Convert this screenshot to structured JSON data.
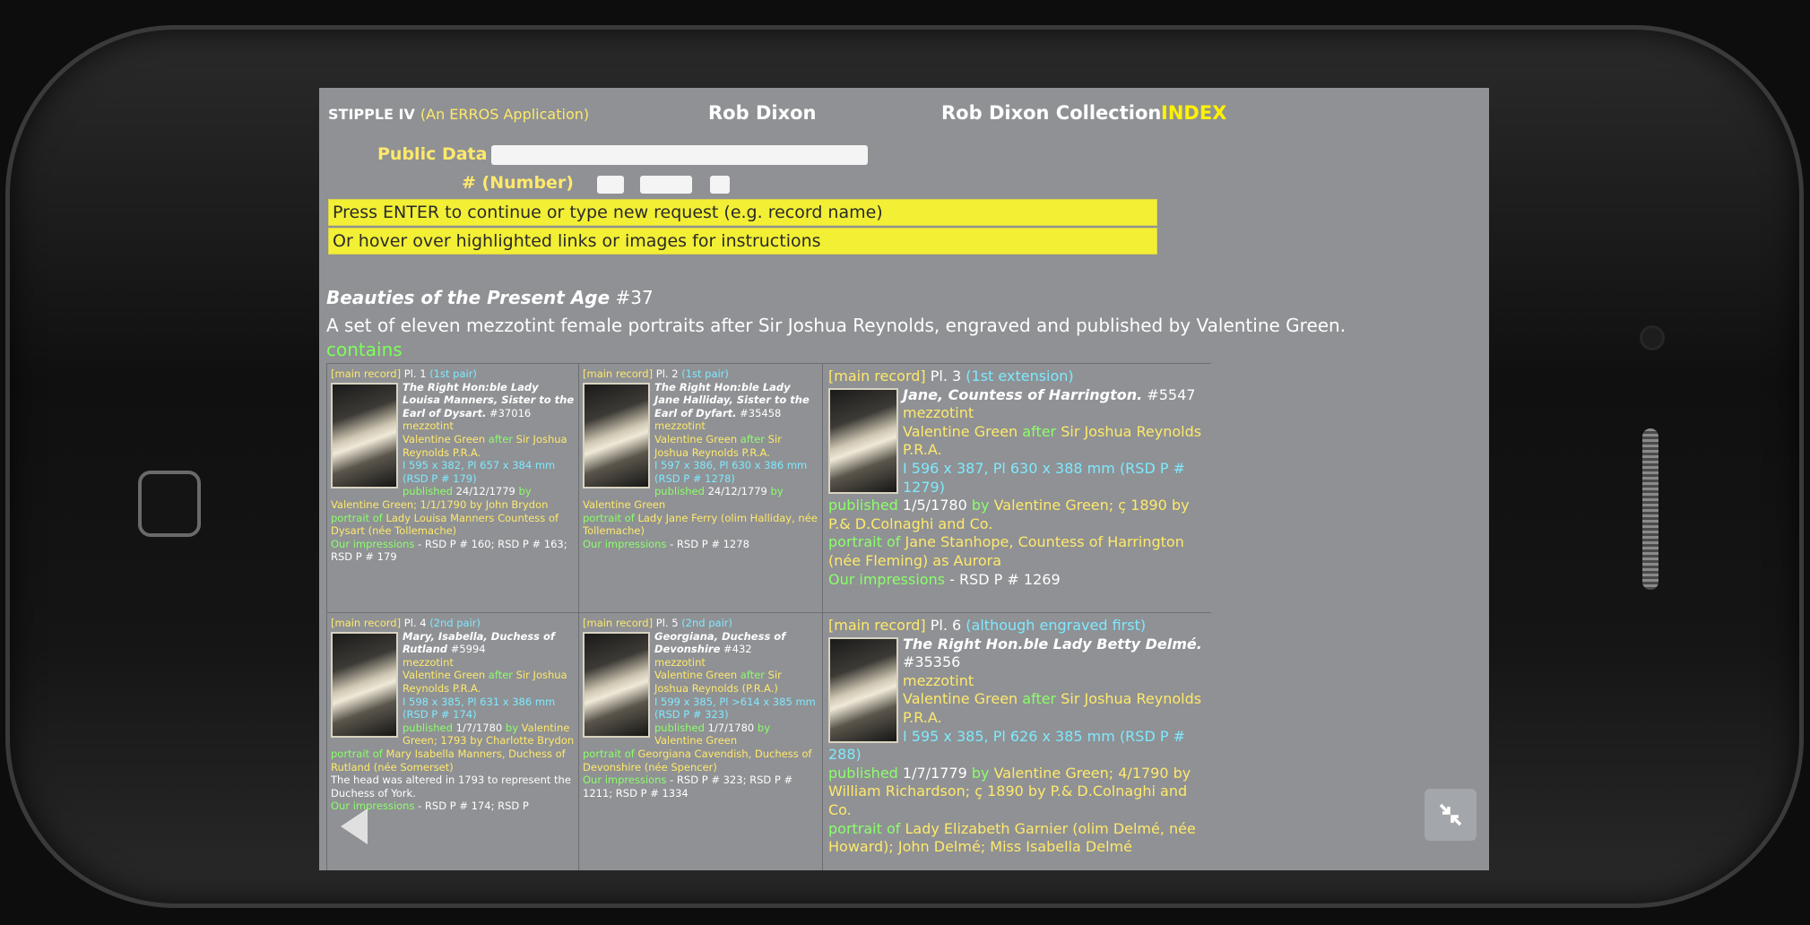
{
  "header": {
    "app_name": "STIPPLE IV",
    "app_sub": "(An ERROS Application)",
    "owner": "Rob Dixon",
    "collection": "Rob Dixon Collection",
    "index_link": "INDEX"
  },
  "search": {
    "public_label": "Public Data",
    "number_label": "# (Number)"
  },
  "notices": [
    "Press ENTER to continue or type new request (e.g. record name)",
    "Or hover over highlighted links or images for instructions"
  ],
  "record": {
    "title": "Beauties of the Present Age",
    "number": "#37",
    "description": "A set of eleven mezzotint female portraits after Sir Joshua Reynolds, engraved and published by Valentine Green.",
    "contains_label": "contains"
  },
  "cells": [
    {
      "main_record": "[main record]",
      "plate": "Pl. 1",
      "pair": "(1st pair)",
      "title": "The Right Hon:ble Lady Louisa Manners, Sister to the Earl of Dysart.",
      "record_no": "#37016",
      "medium": "mezzotint",
      "engraver": "Valentine Green",
      "after_word": "after",
      "artist": "Sir Joshua Reynolds P.R.A.",
      "dimensions": "I 595 x 382, Pl 657 x 384 mm (RSD P # 179)",
      "published_word": "published",
      "published": "24/12/1779",
      "by_word": "by",
      "publisher": "Valentine Green; 1/1/1790 by John Brydon",
      "portrait_word": "portrait of",
      "sitter": "Lady Louisa Manners Countess of Dysart (née Tollemache)",
      "impressions_label": "Our impressions",
      "impressions": "- RSD P # 160; RSD P # 163; RSD P # 179"
    },
    {
      "main_record": "[main record]",
      "plate": "Pl. 2",
      "pair": "(1st pair)",
      "title": "The Right Hon:ble Lady Jane Halliday, Sister to the Earl of Dyfart.",
      "record_no": "#35458",
      "medium": "mezzotint",
      "engraver": "Valentine Green",
      "after_word": "after",
      "artist": "Sir Joshua Reynolds P.R.A.",
      "dimensions": "I 597 x 386, Pl 630 x 386 mm (RSD P # 1278)",
      "published_word": "published",
      "published": "24/12/1779",
      "by_word": "by",
      "publisher": "Valentine Green",
      "portrait_word": "portrait of",
      "sitter": "Lady Jane Ferry (olim Halliday, née Tollemache)",
      "impressions_label": "Our impressions",
      "impressions": "- RSD P # 1278"
    },
    {
      "main_record": "[main record]",
      "plate": "Pl. 3",
      "pair": "(1st extension)",
      "title": "Jane, Countess of Harrington.",
      "record_no": "#5547",
      "medium": "mezzotint",
      "engraver": "Valentine Green",
      "after_word": "after",
      "artist": "Sir Joshua Reynolds P.R.A.",
      "dimensions": "I 596 x 387, Pl 630 x 388 mm (RSD P # 1279)",
      "published_word": "published",
      "published": "1/5/1780",
      "by_word": "by",
      "publisher": "Valentine Green; ç 1890 by P.& D.Colnaghi and Co.",
      "portrait_word": "portrait of",
      "sitter": "Jane Stanhope, Countess of Harrington (née Fleming) as Aurora",
      "impressions_label": "Our impressions",
      "impressions": "- RSD P # 1269"
    },
    {
      "main_record": "[main record]",
      "plate": "Pl. 4",
      "pair": "(2nd pair)",
      "title": "Mary, Isabella, Duchess of Rutland",
      "record_no": "#5994",
      "medium": "mezzotint",
      "engraver": "Valentine Green",
      "after_word": "after",
      "artist": "Sir Joshua Reynolds P.R.A.",
      "dimensions": "I 598 x 385, Pl 631 x 386 mm (RSD P # 174)",
      "published_word": "published",
      "published": "1/7/1780",
      "by_word": "by",
      "publisher": "Valentine Green; 1793 by Charlotte Brydon",
      "portrait_word": "portrait of",
      "sitter": "Mary Isabella Manners, Duchess of Rutland (née Somerset)",
      "note": "The head was altered in 1793 to represent the Duchess of York.",
      "impressions_label": "Our impressions",
      "impressions": "- RSD P # 174; RSD P"
    },
    {
      "main_record": "[main record]",
      "plate": "Pl. 5",
      "pair": "(2nd pair)",
      "title": "Georgiana, Duchess of Devonshire",
      "record_no": "#432",
      "medium": "mezzotint",
      "engraver": "Valentine Green",
      "after_word": "after",
      "artist": "Sir Joshua Reynolds (P.R.A.)",
      "dimensions": "I 599 x 385, Pl >614 x 385 mm (RSD P # 323)",
      "published_word": "published",
      "published": "1/7/1780",
      "by_word": "by",
      "publisher": "Valentine Green",
      "portrait_word": "portrait of",
      "sitter": "Georgiana Cavendish, Duchess of Devonshire (née Spencer)",
      "impressions_label": "Our impressions",
      "impressions": "- RSD P # 323; RSD P # 1211; RSD P # 1334"
    },
    {
      "main_record": "[main record]",
      "plate": "Pl. 6",
      "pair": "(although engraved first)",
      "title": "The Right Hon.ble Lady Betty Delmé.",
      "record_no": "#35356",
      "medium": "mezzotint",
      "engraver": "Valentine Green",
      "after_word": "after",
      "artist": "Sir Joshua Reynolds P.R.A.",
      "dimensions": "I 595 x 385, Pl 626 x 385 mm (RSD P # 288)",
      "published_word": "published",
      "published": "1/7/1779",
      "by_word": "by",
      "publisher": "Valentine Green; 4/1790 by William Richardson; ç 1890 by P.& D.Colnaghi and Co.",
      "portrait_word": "portrait of",
      "sitter": "Lady Elizabeth Garnier (olim Delmé, née Howard); John Delmé; Miss Isabella Delmé",
      "impressions_label": "",
      "impressions": ""
    }
  ],
  "colors": {
    "screen_bg": "#8f9194",
    "notice_bg": "#f2ef35",
    "label_yellow": "#ffe96b",
    "link_cyan": "#7fe9ff",
    "contains_green": "#7dff5a",
    "index_yellow": "#fff200"
  },
  "icons": {
    "back": "left-triangle-arrow",
    "shrink": "compress-arrows"
  }
}
